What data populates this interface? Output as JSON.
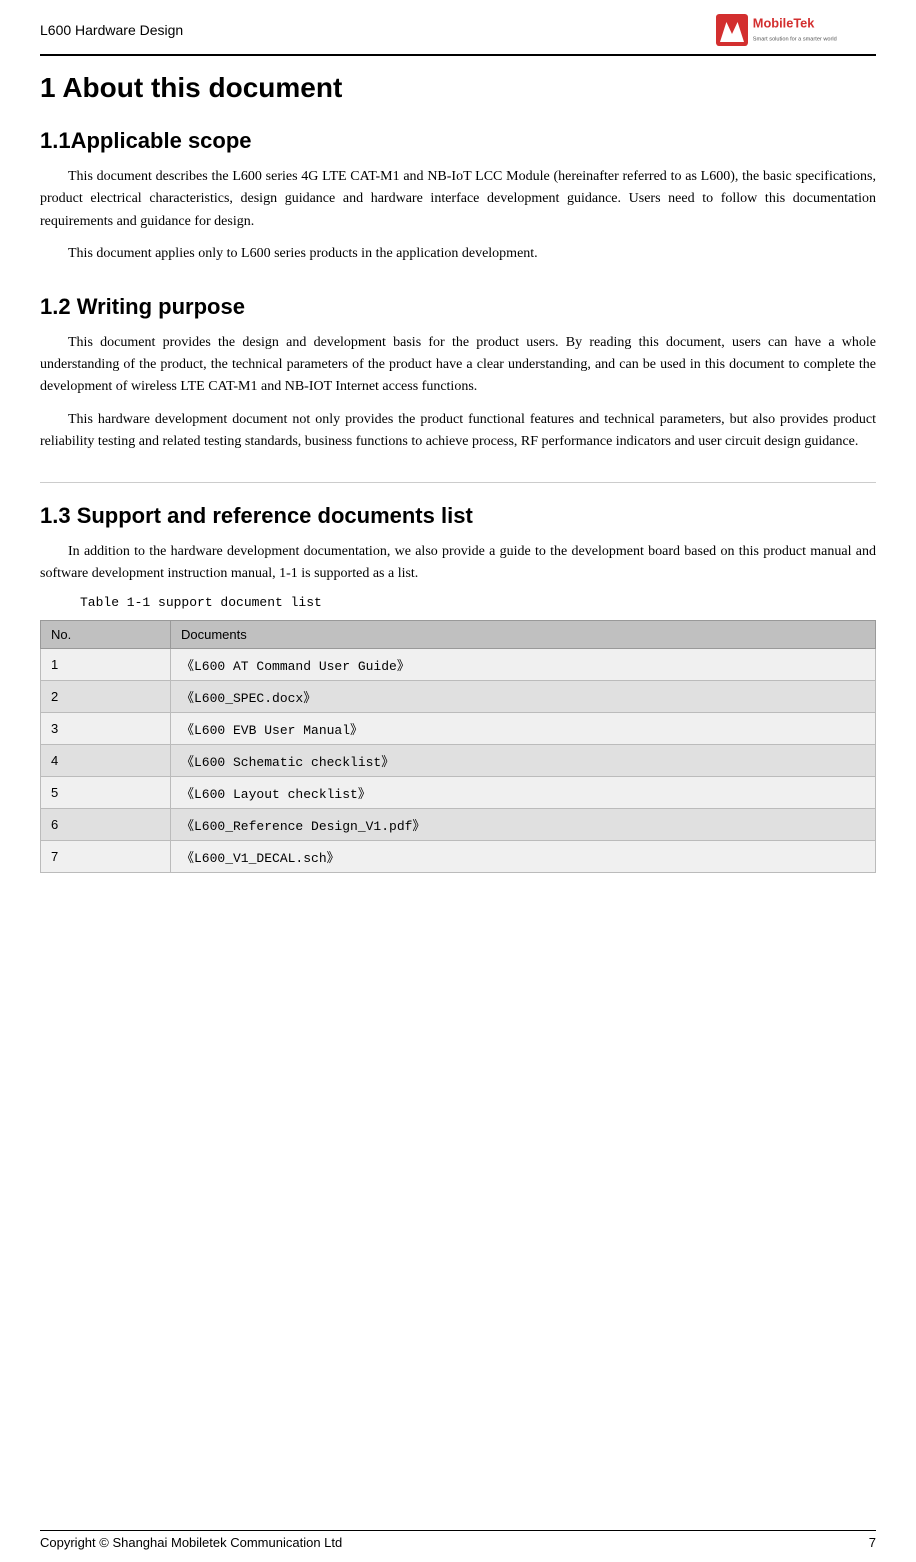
{
  "header": {
    "title": "L600 Hardware Design",
    "logo_alt": "MobileTek logo"
  },
  "sections": {
    "main_title": "1 About this document",
    "section1": {
      "title": "1.1Applicable scope",
      "paragraphs": [
        "This document describes the L600 series 4G LTE CAT-M1 and NB-IoT LCC Module (hereinafter referred to as L600), the basic specifications, product electrical characteristics, design guidance and hardware interface development guidance. Users need to follow this documentation requirements and guidance for design.",
        "This document applies only to L600 series products in the application development."
      ]
    },
    "section2": {
      "title": "1.2 Writing purpose",
      "paragraphs": [
        "This document provides the design and development basis for the product users. By reading this document, users can have a whole understanding of the product, the technical parameters of the product have a clear understanding, and can be used in this document to complete the development of wireless LTE CAT-M1 and NB-IOT Internet access functions.",
        "This hardware development document not only provides the product functional features and technical parameters, but also provides product reliability testing and related testing standards, business functions to achieve process, RF performance indicators and user circuit design guidance."
      ]
    },
    "section3": {
      "title": "1.3 Support and reference documents list",
      "intro": "In addition to the hardware development documentation, we also provide a guide to the development board based on this product manual and software development instruction manual, 1-1 is supported as a list.",
      "table_caption": "Table 1-1 support document list",
      "table": {
        "headers": [
          "No.",
          "Documents"
        ],
        "rows": [
          {
            "no": "1",
            "doc": "《L600 AT Command User Guide》"
          },
          {
            "no": "2",
            "doc": "《L600_SPEC.docx》"
          },
          {
            "no": "3",
            "doc": "《L600 EVB User Manual》"
          },
          {
            "no": "4",
            "doc": "《L600 Schematic checklist》"
          },
          {
            "no": "5",
            "doc": "《L600 Layout checklist》"
          },
          {
            "no": "6",
            "doc": "《L600_Reference Design_V1.pdf》"
          },
          {
            "no": "7",
            "doc": "《L600_V1_DECAL.sch》"
          }
        ]
      }
    }
  },
  "footer": {
    "copyright": "Copyright  ©  Shanghai  Mobiletek  Communication  Ltd",
    "page_number": "7"
  }
}
